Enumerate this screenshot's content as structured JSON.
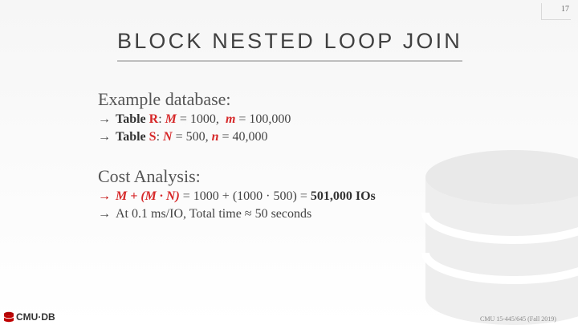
{
  "slide": {
    "page_number": "17",
    "title": "BLOCK NESTED LOOP JOIN",
    "arrow": "→",
    "example": {
      "heading": "Example database:",
      "table_r": {
        "prefix": "Table ",
        "name": "R",
        "colon": ":",
        "M_var": "M",
        "M_val": " = 1000, ",
        "m_var": "m",
        "m_val": " = 100,000"
      },
      "table_s": {
        "prefix": "Table ",
        "name": "S",
        "colon": ":",
        "N_var": "N",
        "N_val": " = 500, ",
        "n_var": "n",
        "n_val": " = 40,000"
      }
    },
    "cost": {
      "heading": "Cost Analysis:",
      "formula": "M + (M · N)",
      "calculation": " = 1000 + (1000 · 500) = ",
      "result": "501,000 IOs",
      "time_text": "At 0.1 ms/IO, Total time ≈ 50 seconds"
    },
    "logo_text": "CMU·DB",
    "footer": "CMU 15-445/645 (Fall 2019)"
  }
}
